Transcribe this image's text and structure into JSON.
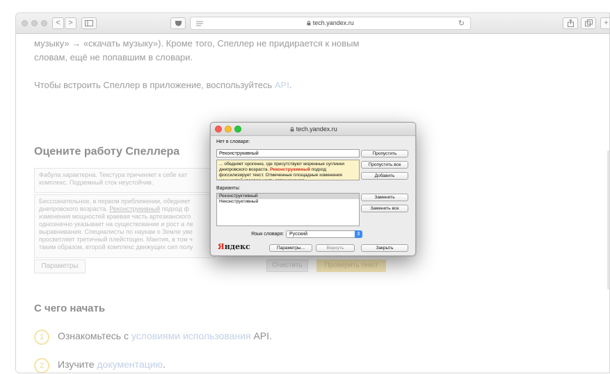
{
  "browser": {
    "url": "tech.yandex.ru",
    "back_glyph": "<",
    "forward_glyph": ">",
    "reload_glyph": "↻"
  },
  "page": {
    "paragraph1_line1": "музыку» → «скачать музыку»). Кроме того, Спеллер не придирается к новым",
    "paragraph1_line2": "словам, ещё не попавшим в словари.",
    "paragraph2_text": "Чтобы встроить Спеллер в приложение, воспользуйтесь ",
    "paragraph2_link": "API",
    "paragraph2_end": ".",
    "heading_rate": "Оцените работу Спеллера",
    "textarea1_line1": "Фабула характерна. Текстура причиняет к себе кат",
    "textarea1_line2": "комплекс. Подземный сток неустойчив.",
    "textarea2_line1": "Бессознательное, в первом приближении, обедняет",
    "textarea2_line2a": "днепровского возраста. ",
    "textarea2_line2b": "Реконструкивный",
    "textarea2_line2c": " подход ф",
    "textarea2_line3": "изменения мощностей краевая часть артезианского",
    "textarea2_line4": "однозначно указывает на существование и рост а ле",
    "textarea2_line5": "выравнивания. Специалисты по наукам о Земле уве",
    "textarea2_line6": "просветляет третичный плейстоцен. Мантия, в том ч",
    "textarea2_line7": "таким образом, второй комплекс движущих сил полу",
    "params_button": "Параметры",
    "clear_button": "Очистить",
    "check_button": "Проверить текст",
    "heading_start": "С чего начать",
    "steps": [
      {
        "num": "1",
        "text": "Ознакомьтесь с ",
        "link": "условиями использования",
        "tail": " API."
      },
      {
        "num": "2",
        "text": "Изучите ",
        "link": "документацию",
        "tail": "."
      }
    ]
  },
  "dialog": {
    "title": "tech.yandex.ru",
    "not_in_dict_label": "Нет в словаре:",
    "word_value": "Реконструкивный",
    "context_before": "... обедняет орогенез, где присутствуют моренные суглинки днепровского возраста. ",
    "context_error": "Реконструкивный",
    "context_after": " подход фоссилизирует текст. Отмеченные площадные изменения мощностей краевая часть артезианского",
    "skip_button": "Пропустить",
    "skip_all_button": "Пропустить все",
    "add_button": "Добавить",
    "variants_label": "Варианты:",
    "variants": [
      "Реконструктивный",
      "Неконструктивный"
    ],
    "replace_button": "Заменить",
    "replace_all_button": "Заменить все",
    "lang_label": "Язык словаря:",
    "lang_value": "Русский",
    "logo_first": "Я",
    "logo_rest": "ндекс",
    "options_button": "Параметры...",
    "back_button": "Вернуть",
    "close_button": "Закрыть"
  }
}
